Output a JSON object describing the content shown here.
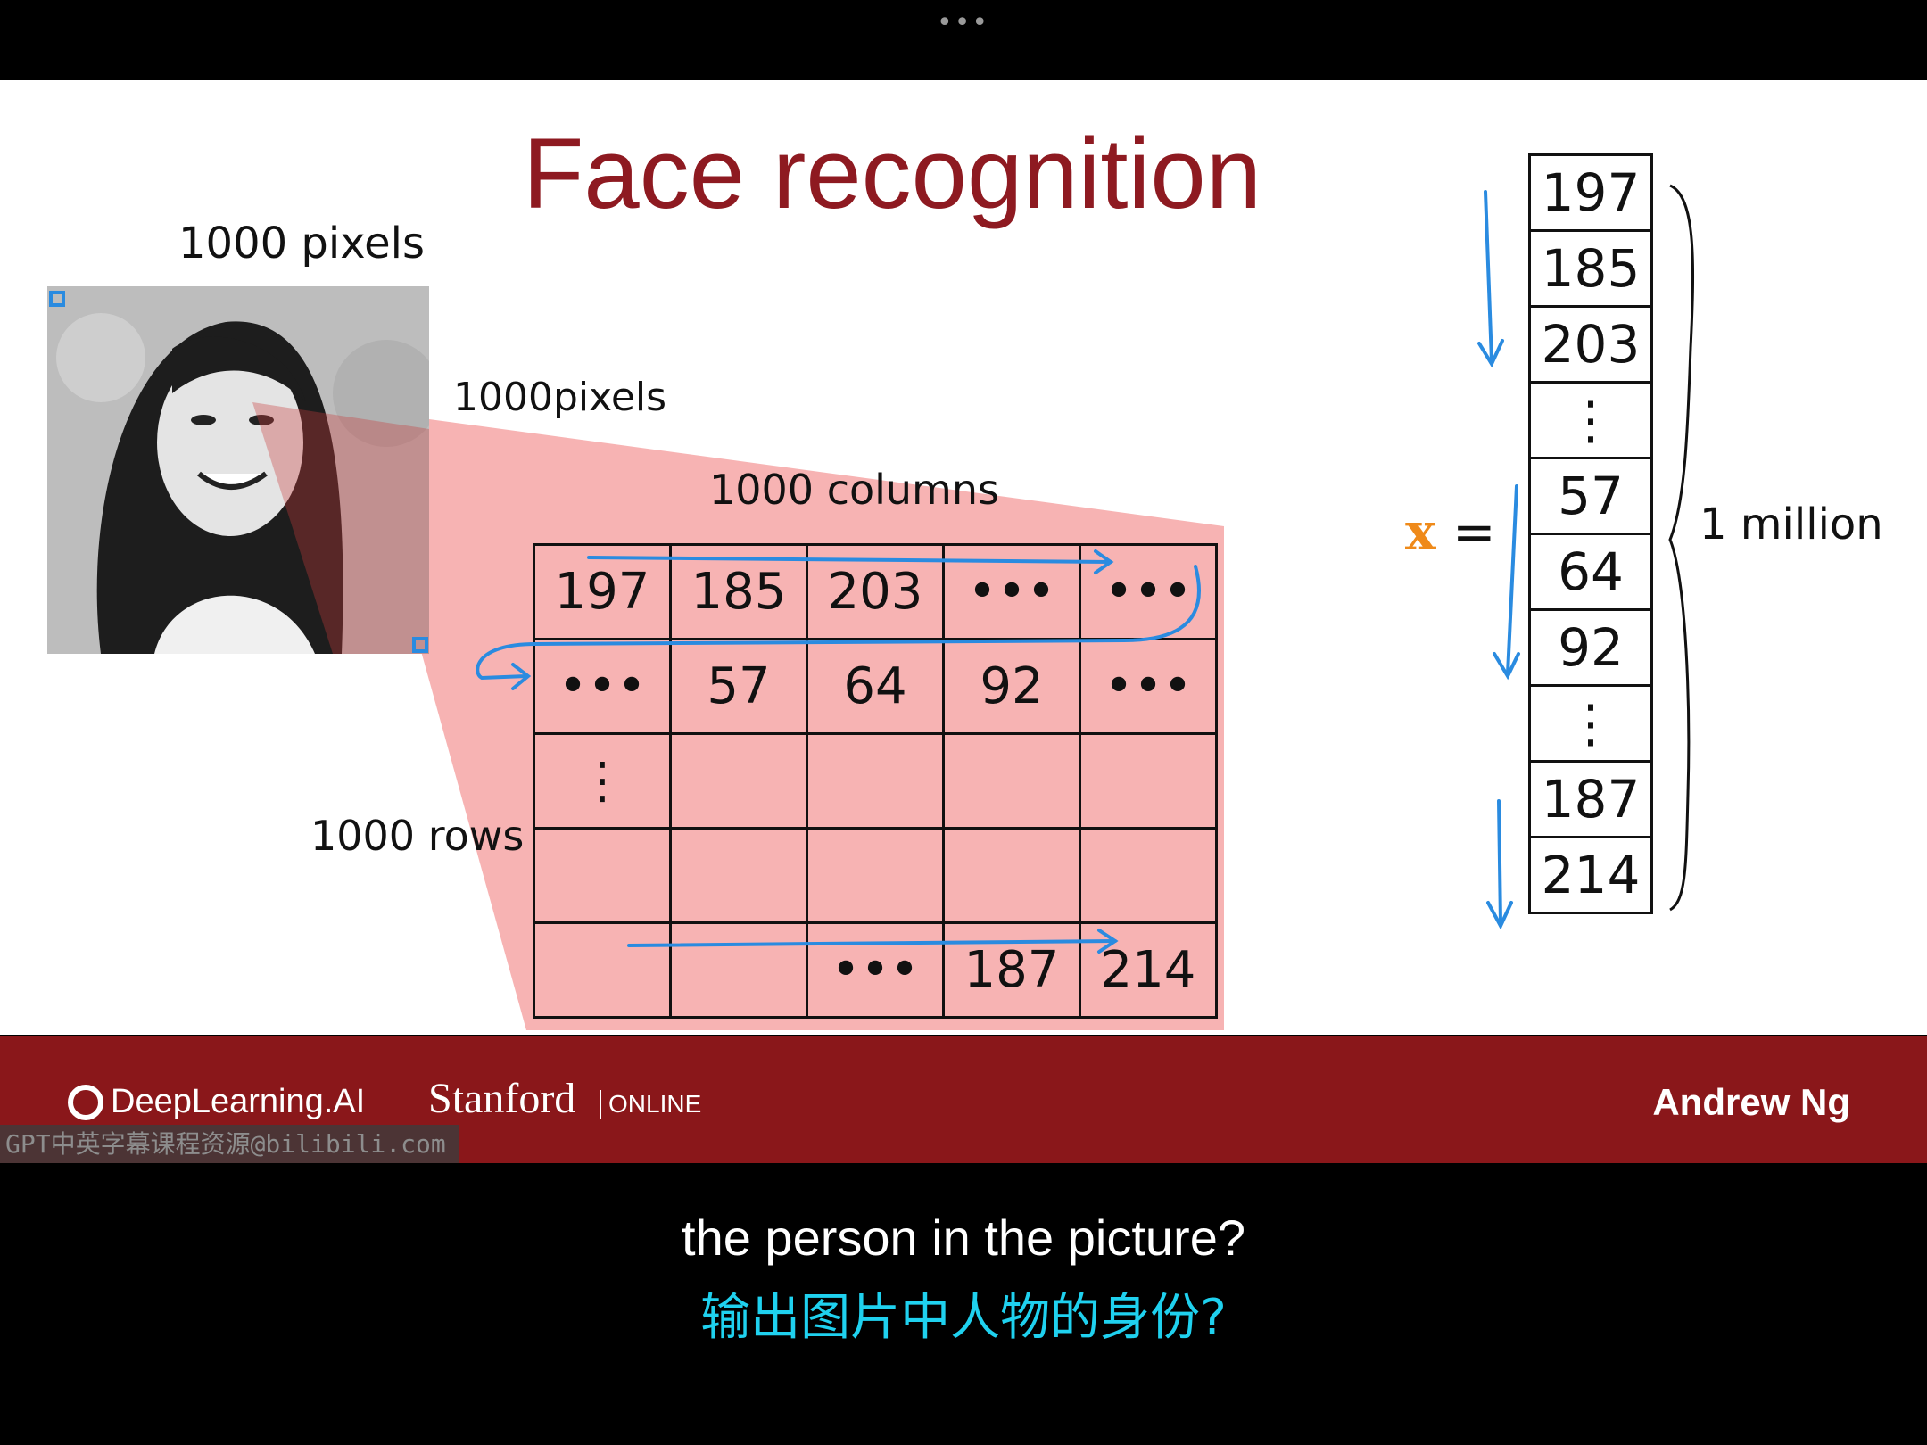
{
  "player": {
    "more_label": "•••"
  },
  "slide": {
    "title": "Face recognition",
    "annotations": {
      "pixels_width": "1000 pixels",
      "pixels_height": "1000pixels",
      "columns": "1000 columns",
      "rows": "1000 rows",
      "million": "1 million",
      "x_symbol": "x",
      "equals": "="
    },
    "grid": [
      [
        "197",
        "185",
        "203",
        "•••",
        "•••"
      ],
      [
        "•••",
        "57",
        "64",
        "92",
        "•••"
      ],
      [
        "⋮",
        "",
        "",
        "",
        ""
      ],
      [
        "",
        "",
        "",
        "",
        ""
      ],
      [
        "",
        "",
        "•••",
        "187",
        "214"
      ]
    ],
    "vector": [
      "197",
      "185",
      "203",
      "⋮",
      "57",
      "64",
      "92",
      "⋮",
      "187",
      "214"
    ],
    "colors": {
      "title": "#8e1a21",
      "arrow": "#2a8be0",
      "wedge": "#f6a6a6",
      "x_vector": "#ef8a1a"
    }
  },
  "footer": {
    "deeplearning": "DeepLearning.AI",
    "stanford": "Stanford",
    "online": "ONLINE",
    "author": "Andrew Ng",
    "watermark": "GPT中英字幕课程资源@bilibili.com"
  },
  "subtitles": {
    "english": "the person in the picture?",
    "chinese": "输出图片中人物的身份?"
  }
}
